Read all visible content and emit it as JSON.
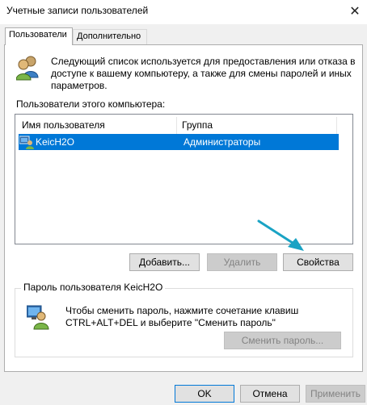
{
  "window": {
    "title": "Учетные записи пользователей",
    "close_glyph": "✕"
  },
  "tabs": [
    {
      "label": "Пользователи",
      "active": true
    },
    {
      "label": "Дополнительно",
      "active": false
    }
  ],
  "description": "Следующий список используется для предоставления или отказа в доступе к вашему компьютеру, а также для смены паролей и иных параметров.",
  "users_section": {
    "label": "Пользователи этого компьютера:",
    "columns": [
      "Имя пользователя",
      "Группа"
    ],
    "rows": [
      {
        "name": "KeicH2O",
        "group": "Администраторы",
        "selected": true
      }
    ]
  },
  "user_buttons": {
    "add": "Добавить...",
    "remove": "Удалить",
    "properties": "Свойства"
  },
  "password_group": {
    "title": "Пароль пользователя KeicH2O",
    "text": "Чтобы сменить пароль, нажмите сочетание клавиш CTRL+ALT+DEL и выберите \"Сменить пароль\"",
    "button": "Сменить пароль..."
  },
  "dialog_buttons": {
    "ok": "OK",
    "cancel": "Отмена",
    "apply": "Применить"
  },
  "colors": {
    "selection": "#0078d7",
    "annotation_arrow": "#1aa3c4"
  },
  "icons": [
    "users-icon",
    "user-row-icon",
    "password-user-icon",
    "close-icon"
  ]
}
